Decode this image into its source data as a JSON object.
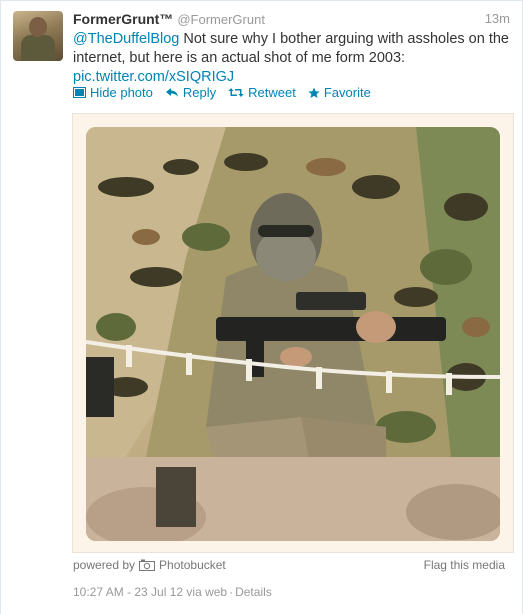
{
  "tweet": {
    "fullname": "FormerGrunt™",
    "username": "@FormerGrunt",
    "time": "13m",
    "mention": "@TheDuffelBlog",
    "text": " Not sure why I bother arguing with assholes on the internet, but here is an actual shot of me form 2003:",
    "pic_link": "pic.twitter.com/xSIQRIGJ"
  },
  "actions": {
    "hide_photo": "Hide photo",
    "reply": "Reply",
    "retweet": "Retweet",
    "favorite": "Favorite"
  },
  "media": {
    "powered_by": "powered by",
    "provider": "Photobucket",
    "flag": "Flag this media"
  },
  "meta": {
    "date": "10:27 AM - 23 Jul 12 via web",
    "dot": "·",
    "details": "Details"
  },
  "colors": {
    "link": "#0084b4",
    "muted": "#999999",
    "text": "#333333"
  }
}
